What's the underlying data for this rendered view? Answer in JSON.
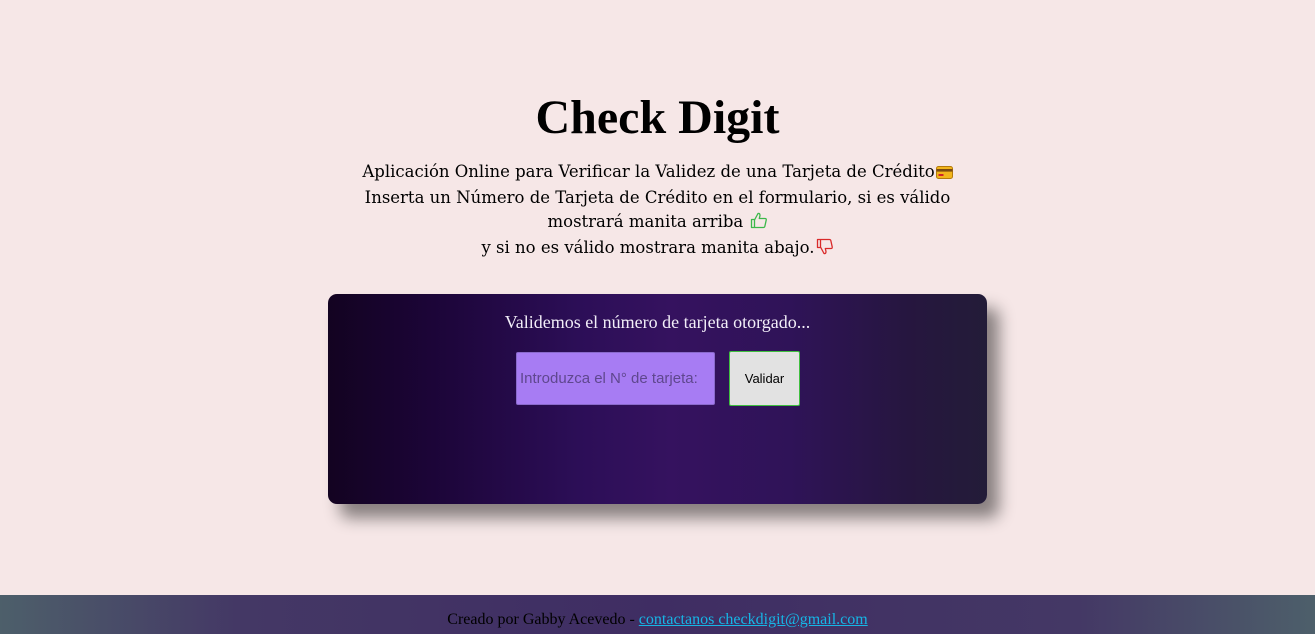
{
  "header": {
    "title": "Check Digit"
  },
  "intro": {
    "line1": "Aplicación Online para Verificar la Validez de una Tarjeta de Crédito",
    "line2": "Inserta un Número de Tarjeta de Crédito en el formulario, si es válido mostrará manita arriba",
    "line3": "y si no es válido mostrara manita abajo.",
    "icons": {
      "card": "credit-card-icon",
      "up": "thumbs-up-icon",
      "down": "thumbs-down-icon"
    }
  },
  "validator": {
    "heading": "Validemos el número de tarjeta otorgado...",
    "input_value": "",
    "input_placeholder": "Introduzca el N° de tarjeta:",
    "button_label": "Validar"
  },
  "footer": {
    "credit": "Creado por Gabby Acevedo -",
    "link_text": "contactanos checkdigit@gmail.com"
  },
  "colors": {
    "background": "#f6e7e7",
    "input": "#a77cf3",
    "button_border": "#3fbf3f",
    "link": "#16b6e6",
    "thumb_up": "#3cb84a",
    "thumb_down": "#d92a2a"
  }
}
